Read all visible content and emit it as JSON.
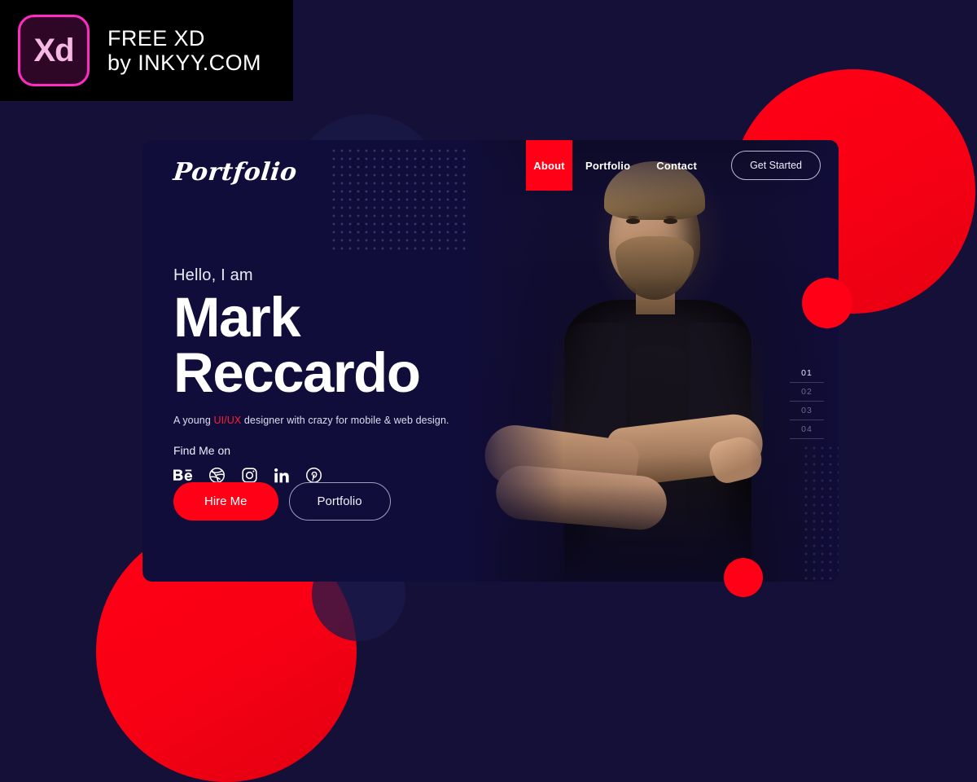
{
  "watermark": {
    "logo_text": "Xd",
    "line1": "FREE XD",
    "line2": "by INKYY.COM"
  },
  "theme": {
    "page_background": "#141038",
    "card_background": "#110d3a",
    "accent_red": "#ff0016",
    "text_light": "#ffffff",
    "muted": "#6a6a95"
  },
  "header": {
    "logo": "Portfolio",
    "nav_items": [
      {
        "label": "About",
        "active": true
      },
      {
        "label": "Portfolio",
        "active": false
      },
      {
        "label": "Contact",
        "active": false
      }
    ],
    "cta_label": "Get Started"
  },
  "hero": {
    "greeting": "Hello, I am",
    "name_line1": "Mark",
    "name_line2": "Reccardo",
    "tagline_before": "A young ",
    "tagline_highlight": "UI/UX",
    "tagline_after": " designer with crazy for mobile & web design.",
    "find_me_label": "Find Me on",
    "socials": [
      {
        "name": "behance-icon",
        "label": "Behance"
      },
      {
        "name": "dribbble-icon",
        "label": "Dribbble"
      },
      {
        "name": "instagram-icon",
        "label": "Instagram"
      },
      {
        "name": "linkedin-icon",
        "label": "LinkedIn"
      },
      {
        "name": "pinterest-icon",
        "label": "Pinterest"
      }
    ],
    "primary_button": "Hire Me",
    "secondary_button": "Portfolio"
  },
  "pager": {
    "items": [
      {
        "number": "01",
        "active": true
      },
      {
        "number": "02",
        "active": false
      },
      {
        "number": "03",
        "active": false
      },
      {
        "number": "04",
        "active": false
      }
    ]
  },
  "portrait": {
    "alt": "Portrait of a bearded man with crossed arms on a dark background"
  }
}
